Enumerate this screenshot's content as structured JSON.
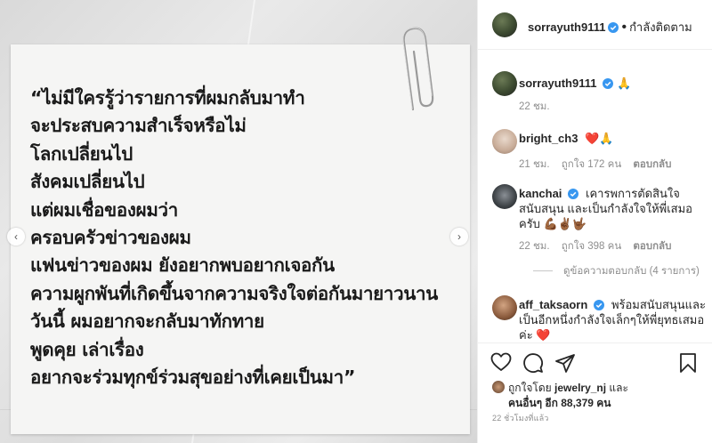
{
  "post": {
    "quote_lines": [
      "“ไม่มีใครรู้ว่ารายการที่ผมกลับมาทำ",
      "จะประสบความสำเร็จหรือไม่",
      "โลกเปลี่ยนไป",
      "สังคมเปลี่ยนไป",
      "แต่ผมเชื่อของผมว่า",
      "ครอบครัวข่าวของผม",
      "แฟนข่าวของผม  ยังอยากพบอยากเจอกัน",
      "ความผูกพันที่เกิดขึ้นจากความจริงใจต่อกันมายาวนาน",
      "วันนี้  ผมอยากจะกลับมาทักทาย",
      "พูดคุย  เล่าเรื่อง",
      "อยากจะร่วมทุกข์ร่วมสุขอย่างที่เคยเป็นมา”"
    ]
  },
  "header": {
    "username": "sorrayuth9111",
    "dot": "•",
    "follow_status": "กำลังติดตาม"
  },
  "comments": [
    {
      "username": "sorrayuth9111",
      "text": "🙏",
      "time": "22 ชม."
    },
    {
      "username": "bright_ch3",
      "text": "❤️🙏",
      "time": "21 ชม.",
      "likes": "ถูกใจ 172 คน",
      "reply": "ตอบกลับ"
    },
    {
      "username": "kanchai",
      "text": "เคารพการตัดสินใจ สนับสนุน และเป็นกำลังใจให้พี่เสมอครับ 💪🏾✌🏾🤟🏾",
      "time": "22 ชม.",
      "likes": "ถูกใจ 398 คน",
      "reply": "ตอบกลับ",
      "view_replies": "ดูข้อความตอบกลับ (4 รายการ)"
    },
    {
      "username": "aff_taksaorn",
      "text": "พร้อมสนับสนุนและเป็นอีกหนึ่งกำลังใจเล็กๆให้พี่ยุทธเสมอค่ะ ❤️"
    }
  ],
  "likes": {
    "prefix": "ถูกใจโดย",
    "liker": "jewelry_nj",
    "and": "และ",
    "others": "คนอื่นๆ อีก 88,379 คน"
  },
  "time_ago": "22 ชั่วโมงที่แล้ว",
  "colors": {
    "verified": "#3897f0",
    "heart": "#ed4956",
    "text": "#262626",
    "muted": "#8e8e8e"
  },
  "icons": [
    "verified-icon",
    "heart-icon",
    "comment-icon",
    "share-icon",
    "bookmark-icon",
    "paperclip-icon",
    "chevron-left-icon",
    "chevron-right-icon"
  ]
}
